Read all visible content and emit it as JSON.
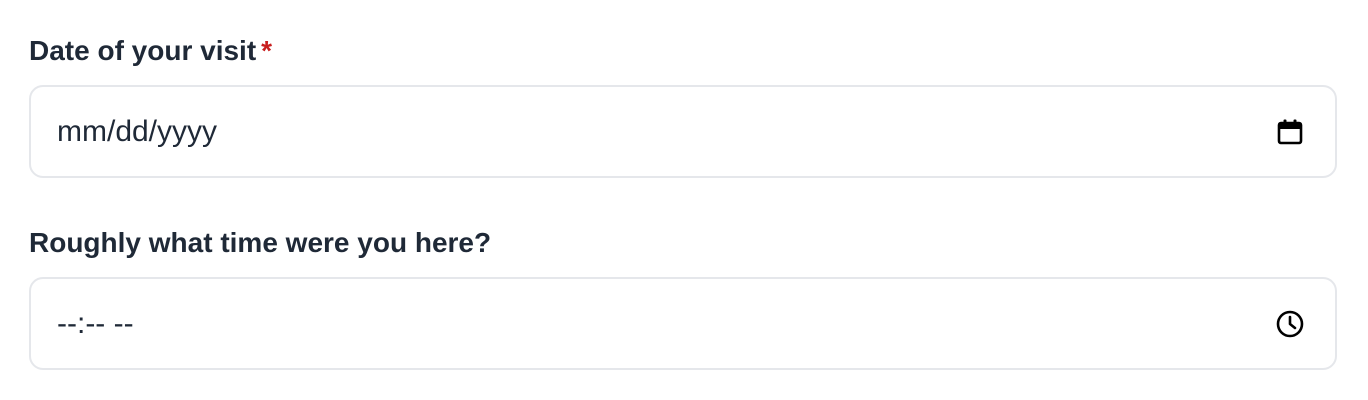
{
  "date_field": {
    "label": "Date of your visit",
    "required_marker": "*",
    "placeholder": "mm/dd/yyyy",
    "icon": "calendar-icon"
  },
  "time_field": {
    "label": "Roughly what time were you here?",
    "placeholder": "--:-- --",
    "icon": "clock-icon"
  },
  "colors": {
    "label_text": "#1f2937",
    "required": "#c81e1e",
    "border": "#e5e7eb"
  }
}
